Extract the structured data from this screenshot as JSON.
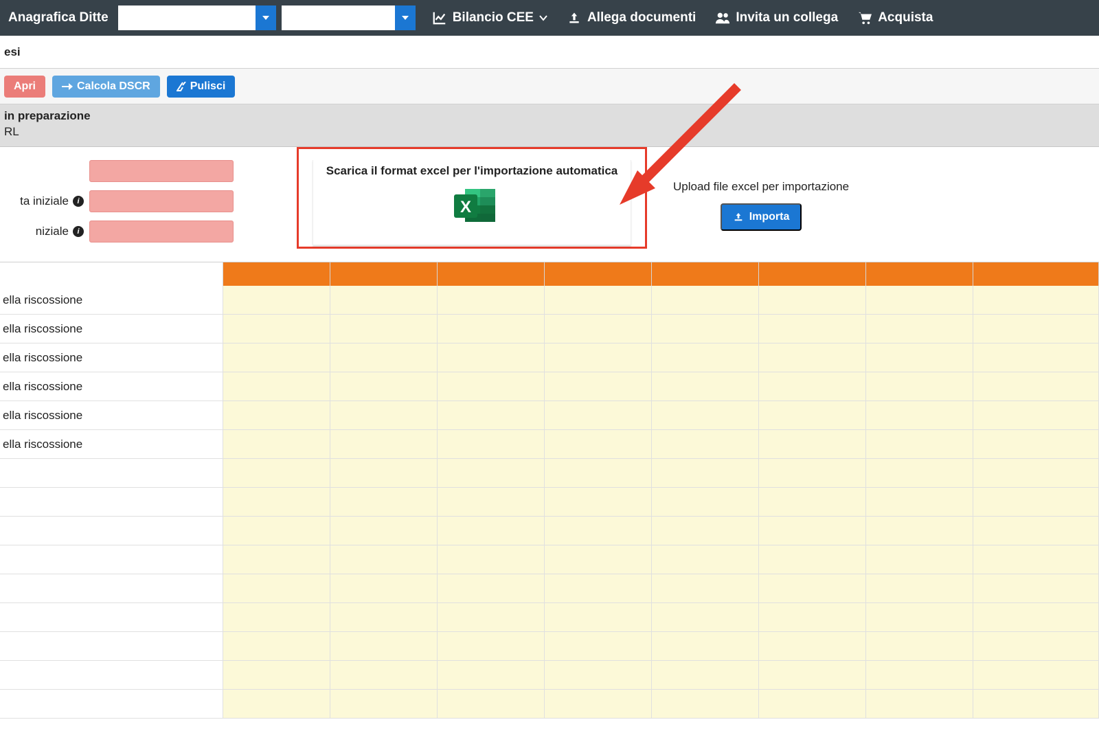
{
  "topbar": {
    "anagrafica_label": "Anagrafica Ditte",
    "nav": {
      "bilancio": "Bilancio CEE",
      "allega": "Allega documenti",
      "invita": "Invita un collega",
      "acquista": "Acquista"
    }
  },
  "subbar_text": "esi",
  "toolbar": {
    "apri": "Apri",
    "calcola": "Calcola DSCR",
    "pulisci": "Pulisci"
  },
  "status": {
    "line1": "in preparazione",
    "line2": "RL"
  },
  "config": {
    "row2_label": "ta iniziale",
    "row3_label": "niziale"
  },
  "download": {
    "title": "Scarica il format excel per l'importazione automatica"
  },
  "upload": {
    "label": "Upload file excel per importazione",
    "button": "Importa"
  },
  "grid": {
    "row_label": "ella riscossione",
    "labeled_rows": 6,
    "blank_rows": 9,
    "columns": 8
  },
  "colors": {
    "orange": "#ef7a1a",
    "blue": "#1b77d3",
    "light_blue": "#5fa6e0",
    "red_btn": "#eb7d79",
    "cell_bg": "#fcf9d8",
    "highlight_border": "#e63b2a",
    "pink_input": "#f3a7a3"
  }
}
